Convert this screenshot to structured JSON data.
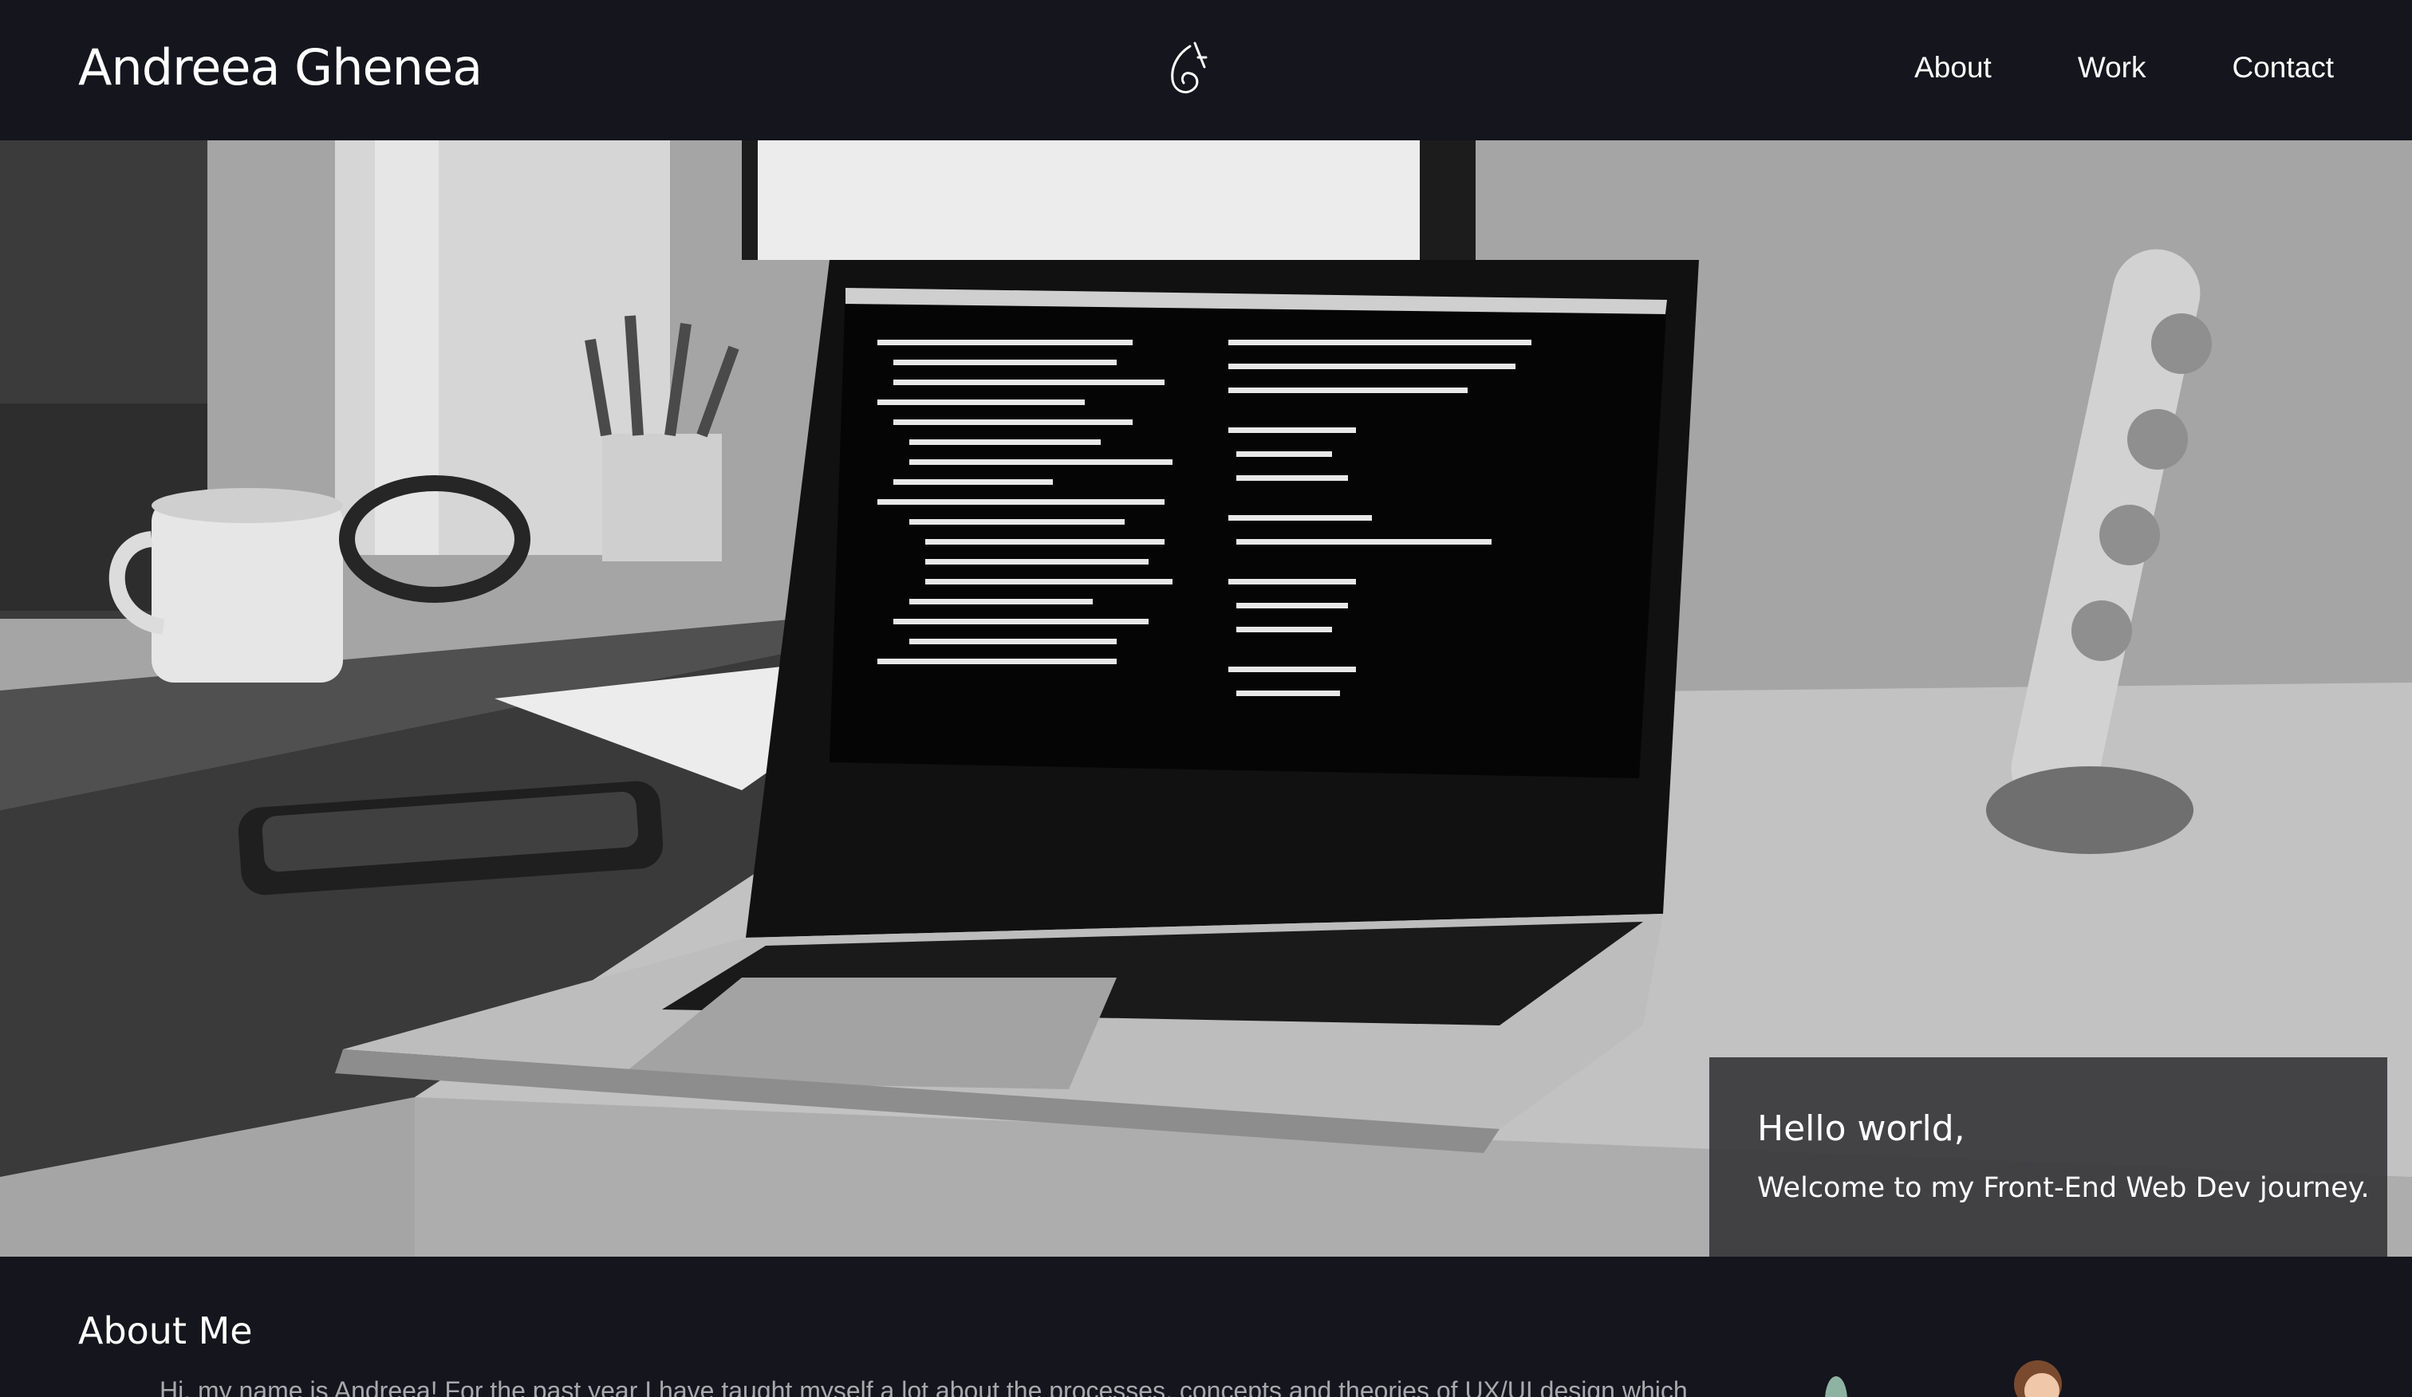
{
  "header": {
    "brand": "Andreea Ghenea",
    "logo_icon": "monogram-ag-icon",
    "nav": [
      {
        "label": "About"
      },
      {
        "label": "Work"
      },
      {
        "label": "Contact"
      }
    ]
  },
  "hero": {
    "greeting": "Hello world,",
    "tagline": "Welcome to my Front-End Web Dev journey.",
    "image_subject": "laptop-on-desk-photo"
  },
  "about": {
    "heading": "About Me",
    "intro": "Hi, my name is Andreea! For the past year I have taught myself a lot about the processes, concepts and theories of UX/UI design which"
  },
  "colors": {
    "background": "#15151d",
    "text": "#ffffff",
    "muted_text": "#a8a8ad",
    "card": "#3a3a3e"
  }
}
